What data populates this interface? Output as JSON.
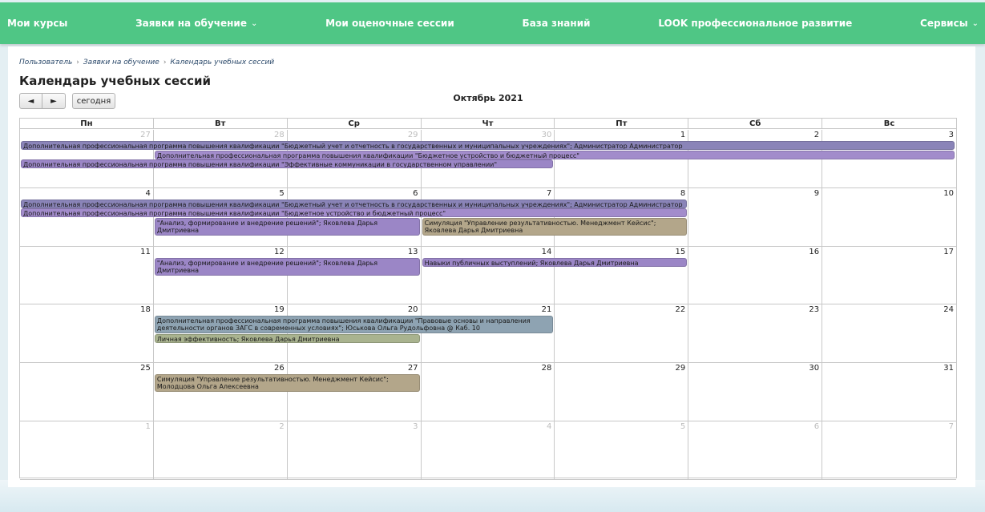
{
  "nav": {
    "items": [
      {
        "label": "Мои курсы",
        "dropdown": false
      },
      {
        "label": "Заявки на обучение",
        "dropdown": true
      },
      {
        "label": "Мои оценочные сессии",
        "dropdown": false
      },
      {
        "label": "База знаний",
        "dropdown": false
      },
      {
        "label": "LOOK профессиональное развитие",
        "dropdown": false
      },
      {
        "label": "Сервисы",
        "dropdown": true
      }
    ],
    "chevron": "⌄"
  },
  "breadcrumb": [
    "Пользователь",
    "Заявки на обучение",
    "Календарь учебных сессий"
  ],
  "breadcrumb_sep": "›",
  "title": "Календарь учебных сессий",
  "controls": {
    "prev": "◄",
    "next": "►",
    "today": "сегодня"
  },
  "month": "Октябрь 2021",
  "weekdays": [
    "Пн",
    "Вт",
    "Ср",
    "Чт",
    "Пт",
    "Сб",
    "Вс"
  ],
  "weeks": [
    [
      {
        "d": "27",
        "o": true
      },
      {
        "d": "28",
        "o": true
      },
      {
        "d": "29",
        "o": true
      },
      {
        "d": "30",
        "o": true
      },
      {
        "d": "1"
      },
      {
        "d": "2"
      },
      {
        "d": "3"
      }
    ],
    [
      {
        "d": "4"
      },
      {
        "d": "5"
      },
      {
        "d": "6"
      },
      {
        "d": "7"
      },
      {
        "d": "8"
      },
      {
        "d": "9"
      },
      {
        "d": "10"
      }
    ],
    [
      {
        "d": "11"
      },
      {
        "d": "12"
      },
      {
        "d": "13"
      },
      {
        "d": "14"
      },
      {
        "d": "15"
      },
      {
        "d": "16"
      },
      {
        "d": "17"
      }
    ],
    [
      {
        "d": "18"
      },
      {
        "d": "19"
      },
      {
        "d": "20"
      },
      {
        "d": "21"
      },
      {
        "d": "22"
      },
      {
        "d": "23"
      },
      {
        "d": "24"
      }
    ],
    [
      {
        "d": "25"
      },
      {
        "d": "26"
      },
      {
        "d": "27"
      },
      {
        "d": "28"
      },
      {
        "d": "29"
      },
      {
        "d": "30"
      },
      {
        "d": "31"
      }
    ],
    [
      {
        "d": "1",
        "o": true
      },
      {
        "d": "2",
        "o": true
      },
      {
        "d": "3",
        "o": true
      },
      {
        "d": "4",
        "o": true
      },
      {
        "d": "5",
        "o": true
      },
      {
        "d": "6",
        "o": true
      },
      {
        "d": "7",
        "o": true
      }
    ]
  ],
  "events": [
    {
      "week": 0,
      "start": 0,
      "end": 6,
      "row": 0,
      "lines": 1,
      "color": "#8a84b8",
      "text": "Дополнительная профессиональная программа повышения квалификации \"Бюджетный учет и отчетность в государственных и муниципальных учреждениях\"; Администратор Администратор"
    },
    {
      "week": 0,
      "start": 1,
      "end": 6,
      "row": 1,
      "lines": 1,
      "color": "#a28ccb",
      "text": "Дополнительная профессиональная программа повышения квалификации \"Бюджетное устройство и бюджетный процесс\""
    },
    {
      "week": 0,
      "start": 0,
      "end": 3,
      "row": 2,
      "lines": 1,
      "color": "#9b86c6",
      "text": "Дополнительная профессиональная программа повышения квалификации \"Эффективные коммуникации в государственном управлении\""
    },
    {
      "week": 1,
      "start": 0,
      "end": 4,
      "row": 0,
      "lines": 1,
      "color": "#8a84b8",
      "text": "Дополнительная профессиональная программа повышения квалификации \"Бюджетный учет и отчетность в государственных и муниципальных учреждениях\"; Администратор Администратор"
    },
    {
      "week": 1,
      "start": 0,
      "end": 4,
      "row": 1,
      "lines": 1,
      "color": "#a28ccb",
      "text": "Дополнительная профессиональная программа повышения квалификации \"Бюджетное устройство и бюджетный процесс\""
    },
    {
      "week": 1,
      "start": 1,
      "end": 2,
      "row": 2,
      "lines": 2,
      "color": "#9b86c6",
      "text": "\"Анализ, формирование и внедрение решений\"; Яковлева Дарья Дмитриевна"
    },
    {
      "week": 1,
      "start": 3,
      "end": 4,
      "row": 2,
      "lines": 2,
      "color": "#b3a68a",
      "text": "Симуляция \"Управление результативностью. Менеджмент Кейсис\"; Яковлева Дарья Дмитриевна"
    },
    {
      "week": 2,
      "start": 1,
      "end": 2,
      "row": 0,
      "lines": 2,
      "color": "#9b86c6",
      "text": "\"Анализ, формирование и внедрение решений\"; Яковлева Дарья Дмитриевна"
    },
    {
      "week": 2,
      "start": 3,
      "end": 4,
      "row": 0,
      "lines": 1,
      "color": "#9b86c6",
      "text": "Навыки публичных выступлений; Яковлева Дарья Дмитриевна"
    },
    {
      "week": 3,
      "start": 1,
      "end": 3,
      "row": 0,
      "lines": 2,
      "color": "#8ea3b2",
      "text": "Дополнительная профессиональная программа повышения квалификации \"Правовые основы и направления деятельности органов ЗАГС в современных условиях\"; Юськова Ольга Рудольфовна @ Каб. 10"
    },
    {
      "week": 3,
      "start": 1,
      "end": 2,
      "row": 2,
      "lines": 1,
      "color": "#a9b38f",
      "text": "Личная эффективность; Яковлева Дарья Дмитриевна"
    },
    {
      "week": 4,
      "start": 1,
      "end": 2,
      "row": 0,
      "lines": 2,
      "color": "#b3a68a",
      "text": "Симуляция \"Управление результативностью. Менеджмент Кейсис\"; Молодцова Ольга Алексеевна"
    }
  ]
}
